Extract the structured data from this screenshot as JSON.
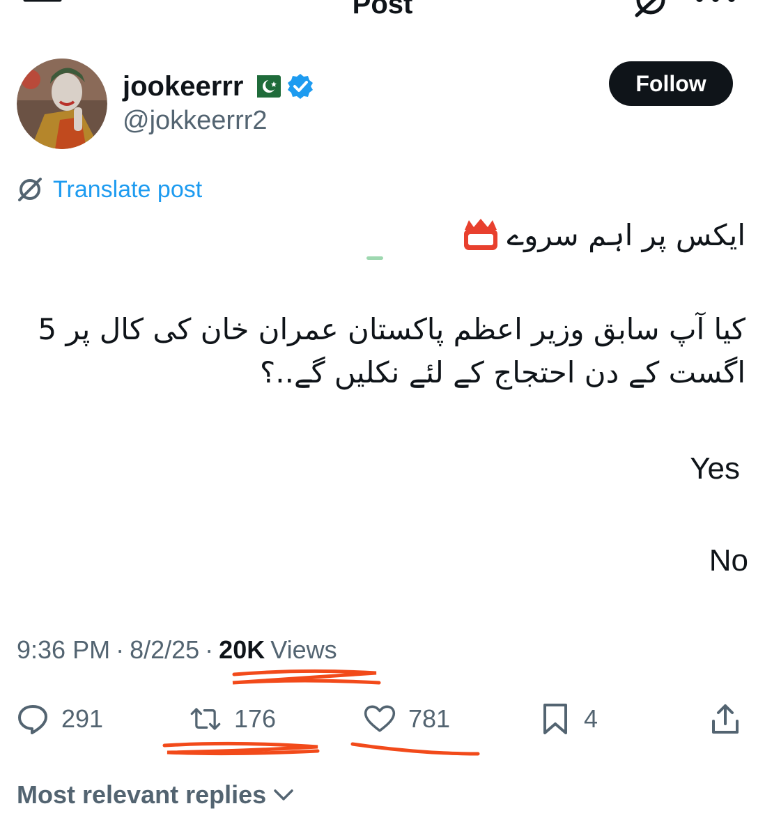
{
  "header": {
    "title": "Post",
    "back_icon": "arrow-left-icon",
    "grok_icon": "grok-icon",
    "more_icon": "more-dots-icon"
  },
  "author": {
    "display_name": "jookeerrr",
    "flag": "pakistan-flag",
    "verified": true,
    "handle": "@jokkeerrr2",
    "follow_label": "Follow"
  },
  "translate": {
    "label": "Translate post"
  },
  "post": {
    "line1": "ایکس پر اہم سروے",
    "line2": "کیا آپ سابق وزیر اعظم پاکستان عمران خان کی کال پر 5 اگست کے دن احتجاج کے لئے نکلیں گے..؟",
    "options": [
      "Yes",
      "No"
    ]
  },
  "meta": {
    "time": "9:36 PM",
    "date": "8/2/25",
    "views_count": "20K",
    "views_label": "Views",
    "separator": "·"
  },
  "actions": {
    "replies": "291",
    "reposts": "176",
    "likes": "781",
    "bookmarks": "4"
  },
  "replies_section": {
    "label": "Most relevant replies"
  },
  "colors": {
    "accent": "#1d9bf0",
    "text": "#0f1419",
    "muted": "#536471",
    "annotation": "#f24a1a"
  }
}
